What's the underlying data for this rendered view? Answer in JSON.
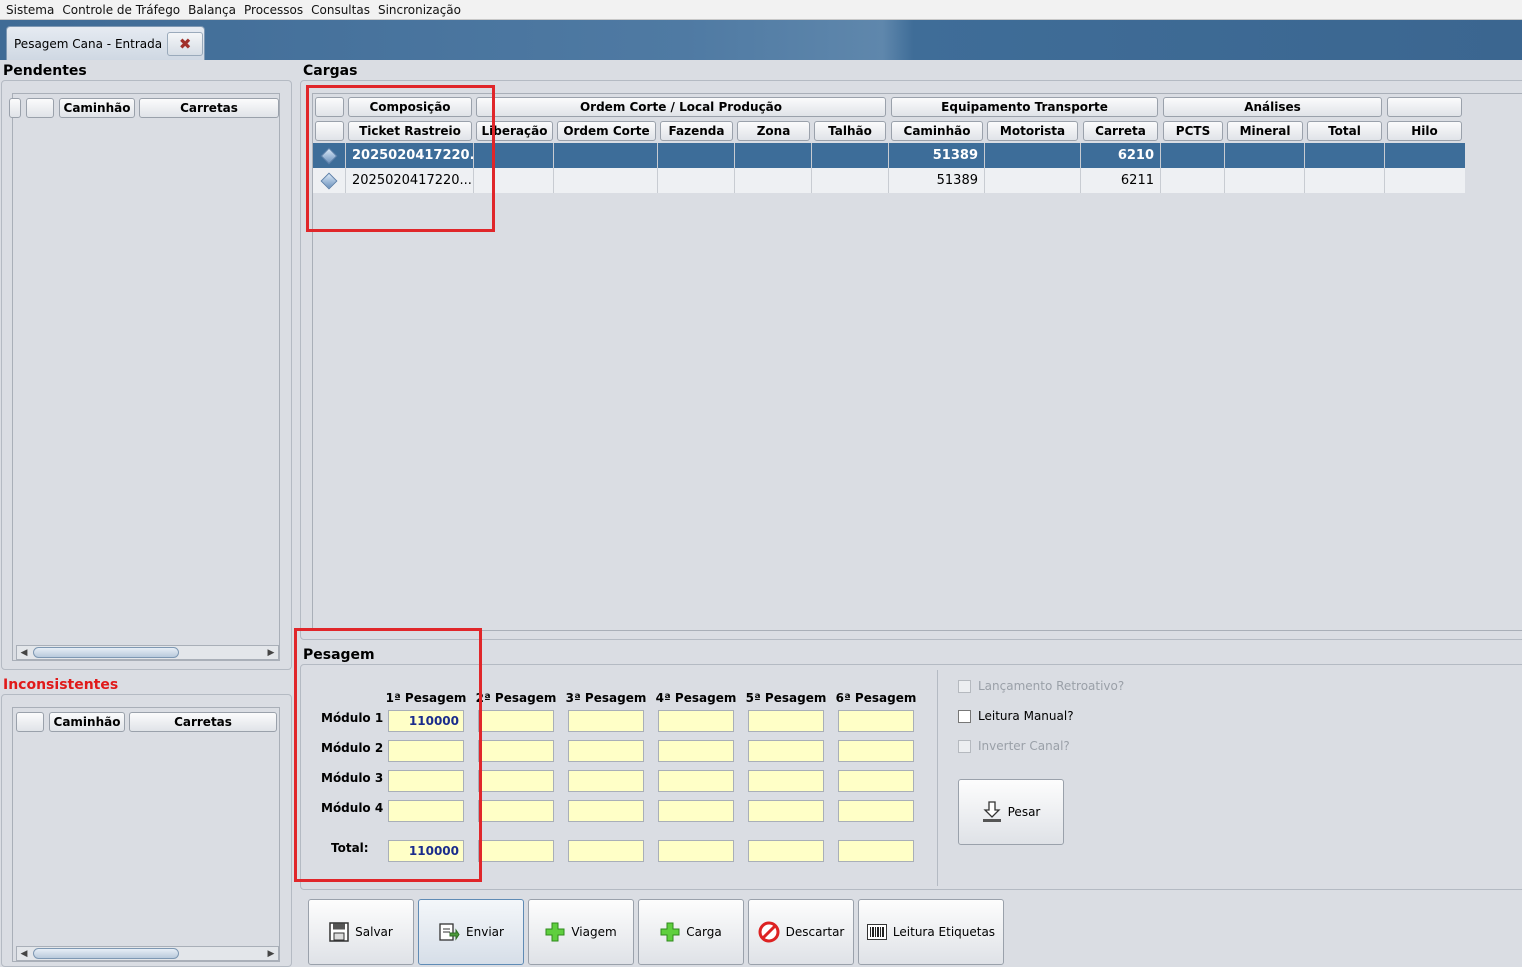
{
  "menu": [
    "Sistema",
    "Controle de Tráfego",
    "Balança",
    "Processos",
    "Consultas",
    "Sincronização"
  ],
  "tab": {
    "label": "Pesagem Cana - Entrada"
  },
  "pendentes": {
    "title": "Pendentes",
    "headers": [
      "",
      "Caminhão",
      "Carretas"
    ]
  },
  "inconsistentes": {
    "title": "Inconsistentes",
    "headers": [
      "",
      "Caminhão",
      "Carretas"
    ]
  },
  "cargas": {
    "title": "Cargas",
    "group_headers": [
      "",
      "Composição",
      "Ordem Corte / Local Produção",
      "Equipamento Transporte",
      "Análises",
      ""
    ],
    "columns": [
      "",
      "Ticket Rastreio",
      "Liberação",
      "Ordem Corte",
      "Fazenda",
      "Zona",
      "Talhão",
      "Caminhão",
      "Motorista",
      "Carreta",
      "PCTS",
      "Mineral",
      "Total",
      "Hilo"
    ],
    "rows": [
      {
        "ticket": "2025020417220...",
        "caminhao": "51389",
        "carreta": "6210",
        "selected": true
      },
      {
        "ticket": "2025020417220...",
        "caminhao": "51389",
        "carreta": "6211",
        "selected": false
      }
    ]
  },
  "pesagem": {
    "title": "Pesagem",
    "columns": [
      "1ª Pesagem",
      "2ª Pesagem",
      "3ª Pesagem",
      "4ª Pesagem",
      "5ª Pesagem",
      "6ª Pesagem"
    ],
    "rows": [
      {
        "label": "Módulo 1",
        "values": [
          "110000",
          "",
          "",
          "",
          "",
          ""
        ]
      },
      {
        "label": "Módulo 2",
        "values": [
          "",
          "",
          "",
          "",
          "",
          ""
        ]
      },
      {
        "label": "Módulo 3",
        "values": [
          "",
          "",
          "",
          "",
          "",
          ""
        ]
      },
      {
        "label": "Módulo 4",
        "values": [
          "",
          "",
          "",
          "",
          "",
          ""
        ]
      },
      {
        "label": "Total:",
        "values": [
          "110000",
          "",
          "",
          "",
          "",
          ""
        ]
      }
    ],
    "options": {
      "retroativo": "Lançamento Retroativo?",
      "leitura_manual": "Leitura Manual?",
      "inverter_canal": "Inverter Canal?"
    },
    "pesar_label": "Pesar"
  },
  "actions": {
    "salvar": "Salvar",
    "enviar": "Enviar",
    "viagem": "Viagem",
    "carga": "Carga",
    "descartar": "Descartar",
    "leitura": "Leitura Etiquetas"
  }
}
